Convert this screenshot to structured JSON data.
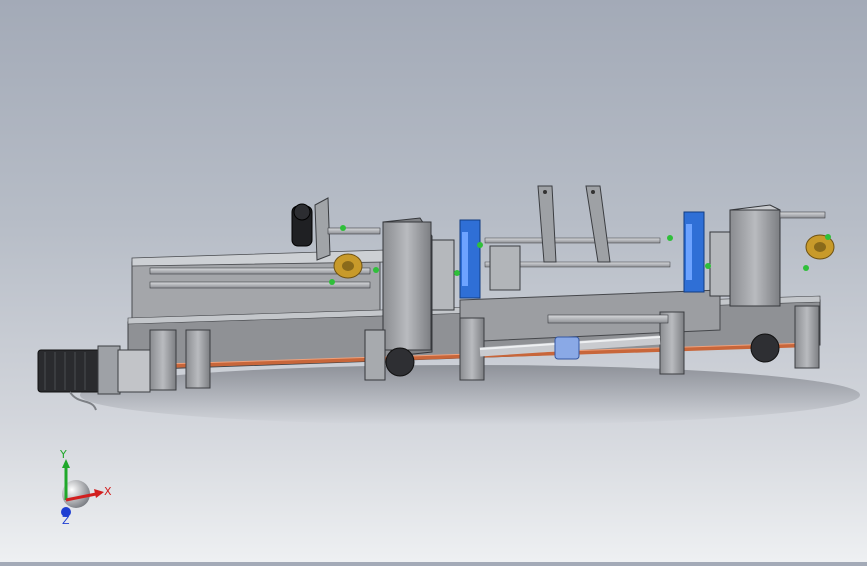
{
  "scene": {
    "subject": "cad-assembly-model",
    "background_top": "#a3aab7",
    "background_bottom": "#eef0f2"
  },
  "triad": {
    "x_label": "X",
    "y_label": "Y",
    "z_label": "Z",
    "x_color": "#d21f1f",
    "y_color": "#1fa82a",
    "z_color": "#1f3fd2"
  },
  "colors": {
    "frame": "#9a9c9f",
    "frame_dark": "#6e7074",
    "steel": "#c9cbcf",
    "motor": "#2a2b2e",
    "brass": "#c89a2a",
    "accent_blue": "#2f6fd6",
    "copper": "#c8663a",
    "bolt_green": "#2fbf3a",
    "coupling": "#8aa9e6"
  }
}
